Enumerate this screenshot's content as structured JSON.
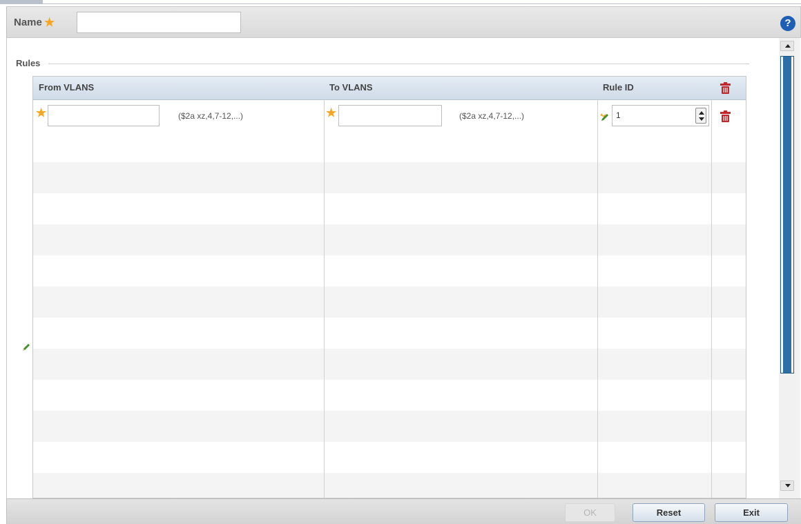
{
  "name_bar": {
    "label": "Name",
    "required_marker": "★",
    "name_value": "",
    "help_glyph": "?"
  },
  "rules": {
    "legend": "Rules",
    "columns": {
      "from_vlans": "From VLANS",
      "to_vlans": "To VLANS",
      "rule_id": "Rule ID"
    },
    "rows": [
      {
        "from_vlans_value": "",
        "from_hint": "($2a xz,4,7-12,...)",
        "to_vlans_value": "",
        "to_hint": "($2a xz,4,7-12,...)",
        "rule_id": "1"
      }
    ]
  },
  "footer": {
    "ok_label": "OK",
    "reset_label": "Reset",
    "exit_label": "Exit"
  },
  "colors": {
    "required_star": "#f5a623",
    "help_icon": "#1c5fb4",
    "delete_icon": "#c0282d",
    "scroll_thumb": "#2e6fa8"
  },
  "icons": [
    "help-icon",
    "delete-icon",
    "edit-pencil-icon",
    "required-star-icon",
    "spinner-up-icon",
    "spinner-down-icon"
  ]
}
